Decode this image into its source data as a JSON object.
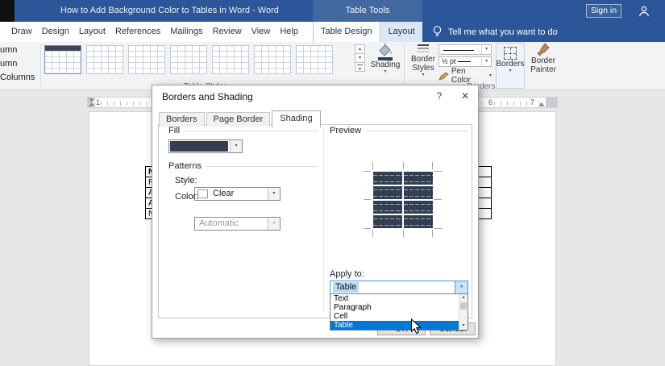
{
  "titlebar": {
    "title": "How to Add Background Color to Tables in Word  -  Word",
    "context": "Table Tools",
    "sign_in": "Sign in"
  },
  "tabs": {
    "items": [
      "Draw",
      "Design",
      "Layout",
      "References",
      "Mailings",
      "Review",
      "View",
      "Help"
    ],
    "contextual": [
      "Table Design",
      "Layout"
    ],
    "tell_me": "Tell me what you want to do"
  },
  "ribbon": {
    "fragments": [
      "umn",
      "umn",
      "Columns"
    ],
    "shading": "Shading",
    "border_styles_1": "Border",
    "border_styles_2": "Styles",
    "pen_weight": "½ pt",
    "pen_color": "Pen Color",
    "borders": "Borders",
    "border_painter_1": "Border",
    "border_painter_2": "Painter",
    "group_table_styles": "Table Styles",
    "group_borders": "Borders"
  },
  "ruler": {
    "n1": "1",
    "n6": "6",
    "n7": "7"
  },
  "document": {
    "col_cells": [
      "N",
      "R",
      "A",
      "A",
      "N"
    ]
  },
  "dialog": {
    "title": "Borders and Shading",
    "tabs": [
      "Borders",
      "Page Border",
      "Shading"
    ],
    "fill_label": "Fill",
    "patterns_label": "Patterns",
    "style_label": "Style:",
    "style_value": "Clear",
    "color_label": "Color:",
    "color_value": "Automatic",
    "preview_label": "Preview",
    "apply_label": "Apply to:",
    "apply_value": "Table",
    "options": [
      "Text",
      "Paragraph",
      "Cell",
      "Table"
    ],
    "ok": "OK",
    "cancel": "Cancel"
  },
  "icons": {
    "up_arrow": "▴",
    "down_arrow": "▾",
    "dropdown_arrow": "▾",
    "help": "?",
    "close": "✕"
  },
  "colors": {
    "fill_swatch": "#333f50",
    "titlebar": "#2b579a",
    "selection": "#0078d7"
  }
}
